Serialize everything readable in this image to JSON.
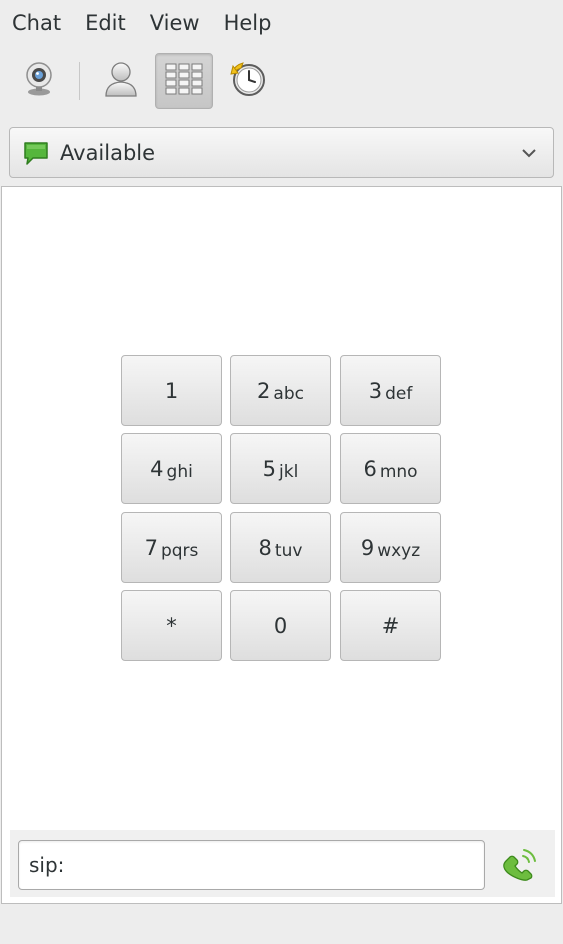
{
  "menu": {
    "items": [
      "Chat",
      "Edit",
      "View",
      "Help"
    ]
  },
  "toolbar": {
    "buttons": [
      {
        "icon": "webcam-icon",
        "active": false
      },
      {
        "icon": "contact-person-icon",
        "active": false
      },
      {
        "icon": "dialpad-icon",
        "active": true
      },
      {
        "icon": "history-clock-icon",
        "active": false
      }
    ]
  },
  "presence": {
    "status": "Available",
    "icon": "speech-bubble-icon",
    "status_color": "#55b63c"
  },
  "dialpad": {
    "keys": [
      {
        "digit": "1",
        "letters": ""
      },
      {
        "digit": "2",
        "letters": "abc"
      },
      {
        "digit": "3",
        "letters": "def"
      },
      {
        "digit": "4",
        "letters": "ghi"
      },
      {
        "digit": "5",
        "letters": "jkl"
      },
      {
        "digit": "6",
        "letters": "mno"
      },
      {
        "digit": "7",
        "letters": "pqrs"
      },
      {
        "digit": "8",
        "letters": "tuv"
      },
      {
        "digit": "9",
        "letters": "wxyz"
      },
      {
        "digit": "*",
        "letters": ""
      },
      {
        "digit": "0",
        "letters": ""
      },
      {
        "digit": "#",
        "letters": ""
      }
    ]
  },
  "call_bar": {
    "address_value": "sip:",
    "call_icon": "phone-handset-icon",
    "call_icon_color": "#6dbd3f"
  }
}
